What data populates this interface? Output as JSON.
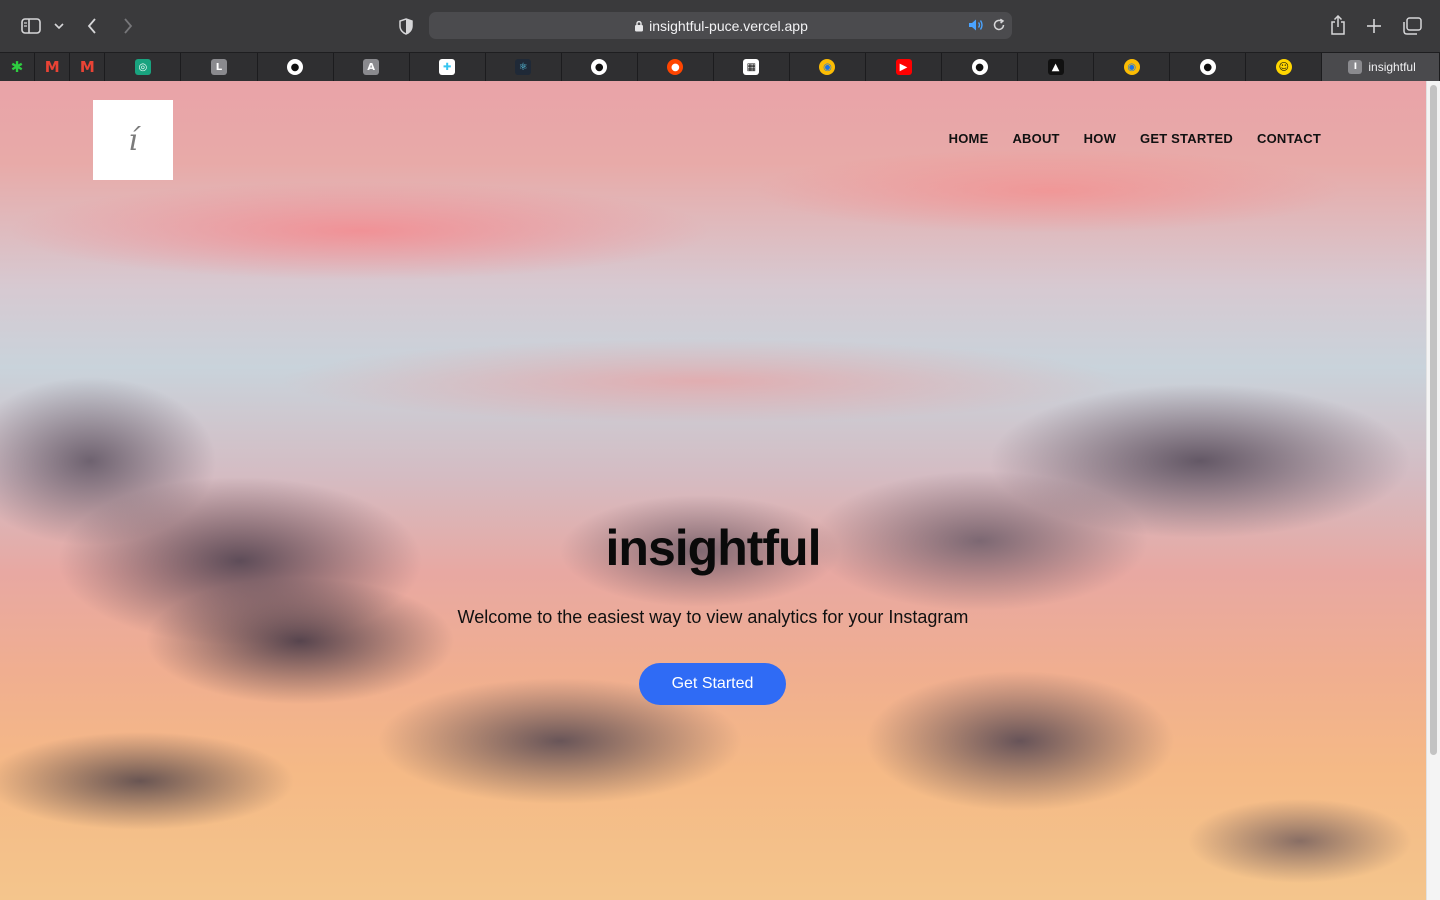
{
  "browser": {
    "url": "insightful-puce.vercel.app",
    "colors": {
      "toolbar": "#3a3a3c",
      "tabbar": "#2a2a2c",
      "active_tab": "#4a4a4d"
    },
    "tabs": [
      {
        "icon": "asterisk-green-icon",
        "glyph": "✱",
        "color": "#2ecc40",
        "bg": "transparent"
      },
      {
        "icon": "gmail-icon",
        "glyph": "M",
        "color": "#ea4335",
        "bg": "transparent"
      },
      {
        "icon": "gmail-icon",
        "glyph": "M",
        "color": "#ea4335",
        "bg": "transparent"
      },
      {
        "icon": "chatgpt-icon",
        "glyph": "◎",
        "color": "#ffffff",
        "bg": "#19a37f"
      },
      {
        "icon": "letter-l-icon",
        "glyph": "L",
        "color": "#ffffff",
        "bg": "#8a8a8e"
      },
      {
        "icon": "github-icon",
        "glyph": "●",
        "color": "#111111",
        "bg": "#ffffff"
      },
      {
        "icon": "letter-a-icon",
        "glyph": "A",
        "color": "#ffffff",
        "bg": "#8a8a8e"
      },
      {
        "icon": "slack-icon",
        "glyph": "✚",
        "color": "#36c5f0",
        "bg": "#ffffff"
      },
      {
        "icon": "react-icon",
        "glyph": "⚛",
        "color": "#61dafb",
        "bg": "#1f2937"
      },
      {
        "icon": "github-icon",
        "glyph": "●",
        "color": "#111111",
        "bg": "#ffffff"
      },
      {
        "icon": "reddit-icon",
        "glyph": "●",
        "color": "#ffffff",
        "bg": "#ff4500"
      },
      {
        "icon": "qr-code-icon",
        "glyph": "▦",
        "color": "#111111",
        "bg": "#ffffff"
      },
      {
        "icon": "chrome-icon",
        "glyph": "◉",
        "color": "#1a73e8",
        "bg": "#fbbc04"
      },
      {
        "icon": "youtube-icon",
        "glyph": "▶",
        "color": "#ffffff",
        "bg": "#ff0000"
      },
      {
        "icon": "github-icon",
        "glyph": "●",
        "color": "#111111",
        "bg": "#ffffff"
      },
      {
        "icon": "vercel-icon",
        "glyph": "▲",
        "color": "#ffffff",
        "bg": "#111111"
      },
      {
        "icon": "chrome-icon",
        "glyph": "◉",
        "color": "#1a73e8",
        "bg": "#fbbc04"
      },
      {
        "icon": "github-icon",
        "glyph": "●",
        "color": "#111111",
        "bg": "#ffffff"
      },
      {
        "icon": "smiley-yellow-icon",
        "glyph": "☺",
        "color": "#111111",
        "bg": "#ffd600"
      }
    ],
    "active_tab": {
      "label": "insightful",
      "favicon_letter": "I"
    }
  },
  "page": {
    "logo_glyph": "í",
    "nav": [
      "HOME",
      "ABOUT",
      "HOW",
      "GET STARTED",
      "CONTACT"
    ],
    "title": "insightful",
    "subtitle": "Welcome to the easiest way to view analytics for your Instagram",
    "cta_label": "Get Started",
    "colors": {
      "cta": "#2f6bf5",
      "text": "#0a0a0a"
    }
  }
}
